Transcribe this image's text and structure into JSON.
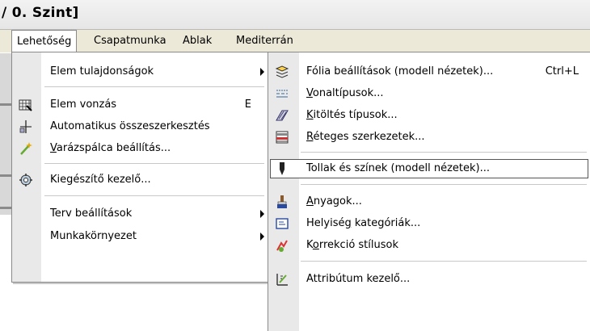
{
  "title": "/ 0. Szint]",
  "menubar": {
    "items": [
      "Lehetőség",
      "Csapatmunka",
      "Ablak",
      "Mediterrán"
    ]
  },
  "menu1": {
    "items": [
      {
        "label": "Elem tulajdonságok",
        "submenu": true,
        "icon": "none"
      },
      {
        "label": "Elem vonzás",
        "shortcut": "E",
        "icon": "magnet-grid-icon"
      },
      {
        "label": "Automatikus összeszerkesztés",
        "icon": "auto-join-icon"
      },
      {
        "label": "Varázspálca beállítás...",
        "icon": "magic-wand-icon"
      },
      {
        "label": "Kiegészítő kezelő...",
        "icon": "addon-manager-icon"
      },
      {
        "label": "Terv beállítások",
        "submenu": true,
        "icon": "none"
      },
      {
        "label": "Munkakörnyezet",
        "submenu": true,
        "icon": "none"
      }
    ]
  },
  "menu2": {
    "items": [
      {
        "label": "Fólia beállítások (modell nézetek)...",
        "shortcut": "Ctrl+L",
        "icon": "layers-icon"
      },
      {
        "label": "Vonaltípusok...",
        "icon": "line-types-icon"
      },
      {
        "label": "Kitöltés típusok...",
        "icon": "fill-types-icon"
      },
      {
        "label": "Réteges szerkezetek...",
        "icon": "composites-icon"
      },
      {
        "label": "Tollak és színek (modell nézetek)...",
        "icon": "pen-icon",
        "highlighted": true
      },
      {
        "label": "Anyagok...",
        "icon": "materials-brush-icon"
      },
      {
        "label": "Helyiség kategóriák...",
        "icon": "zone-categories-icon"
      },
      {
        "label": "Korrekció stílusok",
        "icon": "markup-styles-icon"
      },
      {
        "label": "Attribútum kezelő...",
        "icon": "attribute-manager-icon"
      }
    ]
  }
}
